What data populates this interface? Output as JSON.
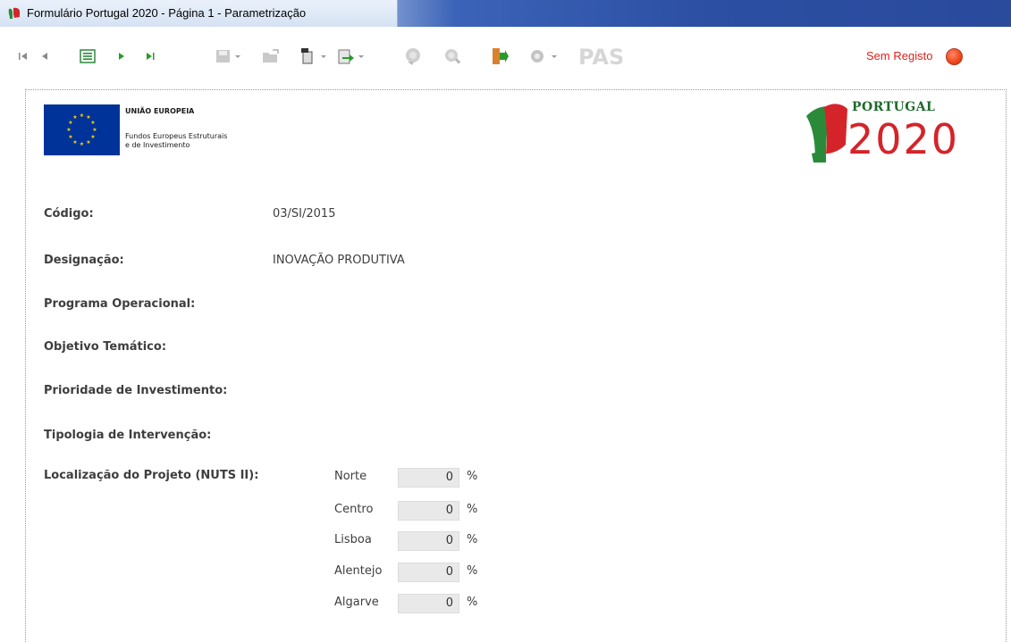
{
  "window": {
    "title": "Formulário Portugal 2020 - Página 1 - Parametrização"
  },
  "toolbar": {
    "nav_icons": [
      "first-page-icon",
      "previous-page-icon",
      "page-list-icon",
      "next-page-icon",
      "last-page-icon"
    ],
    "action_icons": [
      "save-icon",
      "open-icon",
      "import-icon",
      "export-icon",
      "validate-icon",
      "search-icon",
      "exit-icon",
      "settings-icon",
      "pas-icon"
    ],
    "pas_label": "PAS",
    "status_text": "Sem Registo",
    "status_color": "#f04a1e"
  },
  "header": {
    "eu_title": "UNIÃO EUROPEIA",
    "eu_line1": "Fundos Europeus Estruturais",
    "eu_line2": "e de Investimento",
    "pt_word": "PORTUGAL",
    "pt_year": "2020"
  },
  "form": {
    "codigo_label": "Código:",
    "codigo_value": "03/SI/2015",
    "designacao_label": "Designação:",
    "designacao_value": "INOVAÇÃO PRODUTIVA",
    "programa_label": "Programa Operacional:",
    "objetivo_label": "Objetivo Temático:",
    "prioridade_label": "Prioridade de Investimento:",
    "tipologia_label": "Tipologia de Intervenção:",
    "localizacao_label": "Localização do Projeto (NUTS II):",
    "regions": [
      {
        "name": "Norte",
        "value": "0",
        "unit": "%"
      },
      {
        "name": "Centro",
        "value": "0",
        "unit": "%"
      },
      {
        "name": "Lisboa",
        "value": "0",
        "unit": "%"
      },
      {
        "name": "Alentejo",
        "value": "0",
        "unit": "%"
      },
      {
        "name": "Algarve",
        "value": "0",
        "unit": "%"
      }
    ]
  },
  "colors": {
    "accent_red": "#e0221b",
    "eu_blue": "#003399",
    "pt_green": "#1e6b2c",
    "pt_red": "#d4242a"
  }
}
